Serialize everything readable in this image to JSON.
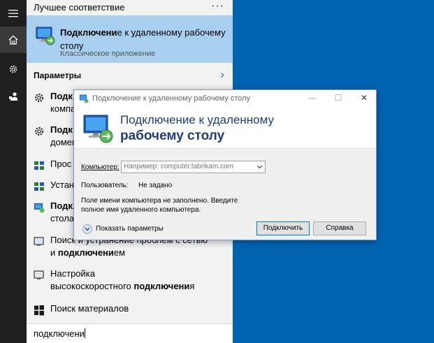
{
  "start_menu": {
    "best_match_header": "Лучшее соответствие",
    "more_label": "···",
    "best_match": {
      "title_bold": "Подключени",
      "title_rest": "е к удаленному рабочему столу",
      "subtitle": "Классическое приложение"
    },
    "settings_header": "Параметры",
    "settings_arrow": "›",
    "items": [
      {
        "bold": "Подк",
        "rest": "",
        "line2": "компа"
      },
      {
        "bold": "Подк",
        "rest": "",
        "line2": "домен"
      },
      {
        "bold": "",
        "rest": "Прос",
        "line2": ""
      },
      {
        "bold": "",
        "rest": "Устан",
        "line2": ""
      },
      {
        "bold": "Подкл",
        "rest": "",
        "line2": "стола"
      },
      {
        "bold": "",
        "rest": "Поиск и устранение проблем с сетью",
        "line2_pre": "и ",
        "line2_bold": "подключени",
        "line2_post": "ем"
      },
      {
        "bold": "",
        "rest": "Настройка",
        "line2_pre": "высокоскоростного ",
        "line2_bold": "подключени",
        "line2_post": "я"
      },
      {
        "bold": "",
        "rest": "Поиск материалов",
        "line2": ""
      }
    ],
    "search_query": "подключени"
  },
  "dialog": {
    "title": "Подключение к удаленному рабочему столу",
    "minimize": "—",
    "maximize": "☐",
    "close": "✕",
    "banner_line1": "Подключение к удаленному",
    "banner_line2": "рабочему столу",
    "computer_label": "Компьютер:",
    "computer_placeholder": "Например: computer.fabrikam.com",
    "user_label": "Пользователь:",
    "user_value": "Не задано",
    "message": "Поле имени компьютера не заполнено. Введите полное имя удаленного компьютера.",
    "show_options": "Показать параметры",
    "connect_button": "Подключить",
    "help_button": "Справка"
  }
}
